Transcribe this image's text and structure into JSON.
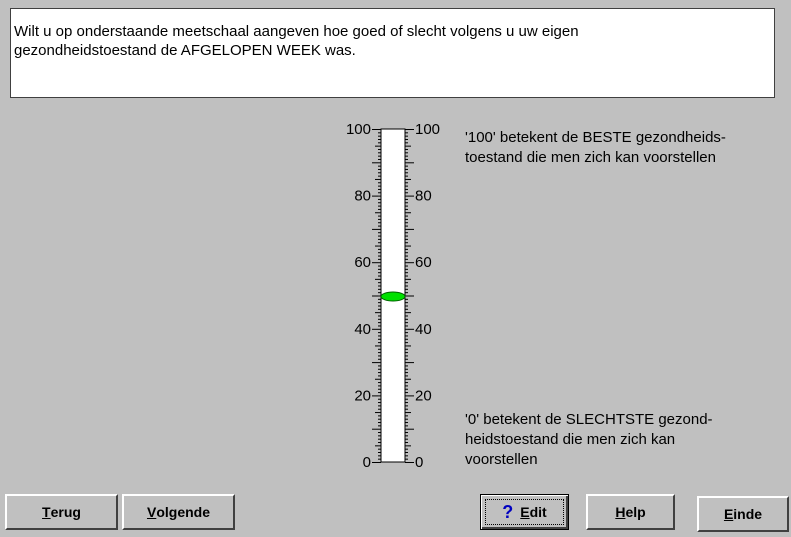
{
  "question": {
    "line1": "Wilt u op onderstaande meetschaal aangeven hoe goed of slecht volgens u uw eigen",
    "line2": "gezondheidstoestand de AFGELOPEN WEEK was."
  },
  "scale": {
    "min": 0,
    "max": 100,
    "major_labels": [
      "100",
      "80",
      "60",
      "40",
      "20",
      "0"
    ],
    "current_value": 50,
    "marker_color": "#00e000"
  },
  "descriptions": {
    "top_line1": "'100' betekent de BESTE gezondheids-",
    "top_line2": "toestand die men zich kan voorstellen",
    "bottom_line1": "'0' betekent de SLECHTSTE gezond-",
    "bottom_line2": "heidstoestand die men zich kan",
    "bottom_line3": "voorstellen"
  },
  "buttons": {
    "back_prefix": "",
    "back_accel": "T",
    "back_rest": "erug",
    "next_accel": "V",
    "next_rest": "olgende",
    "edit_icon": "question-mark-icon",
    "edit_accel": "E",
    "edit_rest": "dit",
    "help_accel": "H",
    "help_rest": "elp",
    "exit_accel": "E",
    "exit_rest": "inde"
  }
}
